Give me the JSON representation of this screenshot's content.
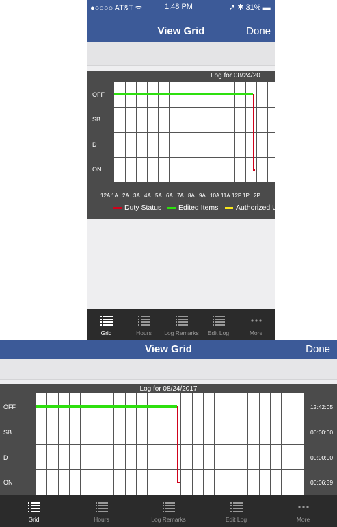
{
  "status_bar": {
    "carrier": "●○○○○ AT&T ᯤ",
    "time": "1:48 PM",
    "right": "➚ ✱ 31% ▬"
  },
  "nav": {
    "title": "View Grid",
    "done_label": "Done"
  },
  "chart": {
    "portrait_title": "Log for 08/24/20",
    "landscape_title": "Log for 08/24/2017",
    "rows": [
      "OFF",
      "SB",
      "D",
      "ON"
    ],
    "hour_labels": [
      "12A",
      "1A",
      "2A",
      "3A",
      "4A",
      "5A",
      "6A",
      "7A",
      "8A",
      "9A",
      "10A",
      "11A",
      "12P",
      "1P",
      "2P"
    ],
    "totals": [
      "12:42:05",
      "00:00:00",
      "00:00:00",
      "00:06:39"
    ],
    "legend": [
      {
        "label": "Duty Status",
        "color": "#d0021b"
      },
      {
        "label": "Edited Items",
        "color": "#2ee00f"
      },
      {
        "label": "Authorized U",
        "color": "#f8e71c"
      }
    ]
  },
  "chart_data": {
    "type": "line",
    "title": "Log for 08/24/2017",
    "categories": [
      "OFF",
      "SB",
      "D",
      "ON"
    ],
    "x_labels": [
      "12A",
      "1A",
      "2A",
      "3A",
      "4A",
      "5A",
      "6A",
      "7A",
      "8A",
      "9A",
      "10A",
      "11A",
      "12P",
      "1P",
      "2P"
    ],
    "series": [
      {
        "name": "Edited Items",
        "color": "#2ee00f",
        "segments": [
          {
            "status": "OFF",
            "start_hour": 0,
            "end_hour": 12.7
          }
        ]
      },
      {
        "name": "Duty Status",
        "color": "#d0021b",
        "segments": [
          {
            "status": "OFF",
            "hour": 12.7
          },
          {
            "status": "ON",
            "start_hour": 12.7,
            "end_hour": 12.8
          }
        ]
      }
    ],
    "totals": {
      "OFF": "12:42:05",
      "SB": "00:00:00",
      "D": "00:00:00",
      "ON": "00:06:39"
    }
  },
  "tabs": [
    {
      "label": "Grid",
      "icon": "grid-list-icon",
      "active": true
    },
    {
      "label": "Hours",
      "icon": "hours-list-icon",
      "active": false
    },
    {
      "label": "Log Remarks",
      "icon": "log-remarks-list-icon",
      "active": false
    },
    {
      "label": "Edit Log",
      "icon": "edit-log-list-icon",
      "active": false
    },
    {
      "label": "More",
      "icon": "more-icon",
      "active": false
    }
  ],
  "colors": {
    "nav": "#3c5a98",
    "chart_bg": "#4b4b4b",
    "tabbar": "#2b2b2b",
    "green": "#2ee00f",
    "red": "#d0021b",
    "yellow": "#f8e71c"
  }
}
